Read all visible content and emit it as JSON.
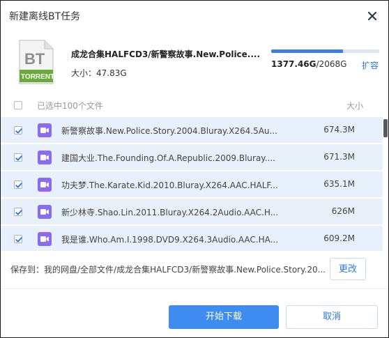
{
  "dialog": {
    "title": "新建离线BT任务"
  },
  "torrent": {
    "badge_top": "BT",
    "badge_bottom": "TORRENT",
    "name": "成龙合集HALFCD3/新警察故事.New.Police....",
    "size_text": "大小：47.83G",
    "progress_fraction": 0.667,
    "progress_used": "1377.46G",
    "progress_total": "/2068G",
    "expand_label": "扩容"
  },
  "list": {
    "header_label": "已选中100个文件",
    "size_header": "大小",
    "files": [
      {
        "name": "新警察故事.New.Police.Story.2004.Bluray.X264.5Au...",
        "size": "674.3M",
        "checked": true
      },
      {
        "name": "建国大业.The.Founding.Of.A.Republic.2009.Bluray....",
        "size": "671.3M",
        "checked": true
      },
      {
        "name": "功夫梦.The.Karate.Kid.2010.Bluray.X264.AAC.HALF...",
        "size": "635.1M",
        "checked": true
      },
      {
        "name": "新少林寺.Shao.Lin.2011.Bluray.X264.2Audio.AAC.H...",
        "size": "626M",
        "checked": true
      },
      {
        "name": "我是谁.Who.Am.I.1998.DVD9.X264.3Audio.AAC.HA...",
        "size": "609.2M",
        "checked": true
      }
    ]
  },
  "save": {
    "path_text": "保存到：我的网盘/全部文件/成龙合集HALFCD3/新警察故事.New.Police.Story.20...",
    "change_label": "更改"
  },
  "actions": {
    "start_label": "开始下载",
    "cancel_label": "取消"
  },
  "colors": {
    "accent": "#3e8cf0",
    "link": "#2a79e8",
    "row_bg": "#e8f0fc",
    "torrent_green": "#6aaa3a",
    "file_icon_purple": "#8b6cf0"
  }
}
